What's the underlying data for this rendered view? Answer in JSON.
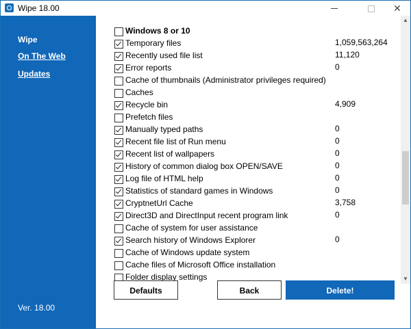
{
  "window": {
    "title": "Wipe 18.00",
    "controls": {
      "minimize": "minimize",
      "maximize": "maximize",
      "close": "✕"
    }
  },
  "sidebar": {
    "items": [
      {
        "label": "Wipe",
        "underlined": false
      },
      {
        "label": "On The Web",
        "underlined": true
      },
      {
        "label": "Updates",
        "underlined": true
      }
    ],
    "version": "Ver. 18.00",
    "color": "#1167b8"
  },
  "list": {
    "items": [
      {
        "label": "Windows 8 or 10",
        "checked": false,
        "value": "",
        "bold": true
      },
      {
        "label": "Temporary files",
        "checked": true,
        "value": "1,059,563,264"
      },
      {
        "label": "Recently used file list",
        "checked": true,
        "value": "11,120"
      },
      {
        "label": "Error reports",
        "checked": true,
        "value": "0"
      },
      {
        "label": "Cache of thumbnails (Administrator privileges required)",
        "checked": false,
        "value": ""
      },
      {
        "label": "Caches",
        "checked": false,
        "value": ""
      },
      {
        "label": "Recycle bin",
        "checked": true,
        "value": "4,909"
      },
      {
        "label": "Prefetch files",
        "checked": false,
        "value": ""
      },
      {
        "label": "Manually typed paths",
        "checked": true,
        "value": "0"
      },
      {
        "label": "Recent file list of Run menu",
        "checked": true,
        "value": "0"
      },
      {
        "label": "Recent list of wallpapers",
        "checked": true,
        "value": "0"
      },
      {
        "label": "History of common dialog box OPEN/SAVE",
        "checked": true,
        "value": "0"
      },
      {
        "label": "Log file of HTML help",
        "checked": true,
        "value": "0"
      },
      {
        "label": "Statistics of standard games in Windows",
        "checked": true,
        "value": "0"
      },
      {
        "label": "CryptnetUrl Cache",
        "checked": true,
        "value": "3,758"
      },
      {
        "label": "Direct3D and DirectInput recent program link",
        "checked": true,
        "value": "0"
      },
      {
        "label": "Cache of system for user assistance",
        "checked": false,
        "value": ""
      },
      {
        "label": "Search history of Windows Explorer",
        "checked": true,
        "value": "0"
      },
      {
        "label": "Cache of Windows update system",
        "checked": false,
        "value": ""
      },
      {
        "label": "Cache files of Microsoft Office installation",
        "checked": false,
        "value": ""
      },
      {
        "label": "Folder display settings",
        "checked": false,
        "value": ""
      }
    ]
  },
  "buttons": {
    "defaults": "Defaults",
    "back": "Back",
    "delete": "Delete!"
  },
  "scrollbar": {
    "up": "▲",
    "down": "▼"
  }
}
